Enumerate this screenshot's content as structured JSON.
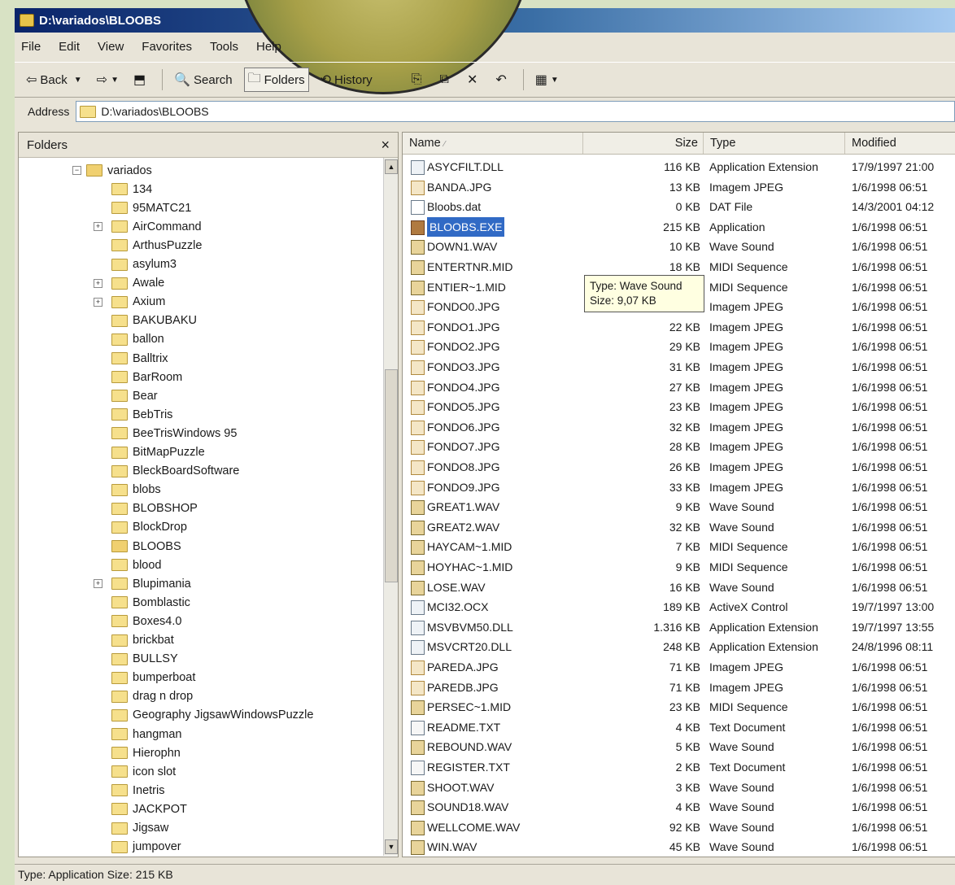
{
  "window": {
    "title": "D:\\variados\\BLOOBS"
  },
  "menu": [
    "File",
    "Edit",
    "View",
    "Favorites",
    "Tools",
    "Help"
  ],
  "toolbar": {
    "back": "Back",
    "search": "Search",
    "folders": "Folders",
    "history": "History"
  },
  "address": {
    "label": "Address",
    "value": "D:\\variados\\BLOOBS"
  },
  "folders_pane": {
    "title": "Folders",
    "close": "×",
    "root": "variados",
    "items": [
      "134",
      "95MATC21",
      "AirCommand",
      "ArthusPuzzle",
      "asylum3",
      "Awale",
      "Axium",
      "BAKUBAKU",
      "ballon",
      "Balltrix",
      "BarRoom",
      "Bear",
      "BebTris",
      "BeeTrisWindows 95",
      "BitMapPuzzle",
      "BleckBoardSoftware",
      "blobs",
      "BLOBSHOP",
      "BlockDrop",
      "BLOOBS",
      "blood",
      "Blupimania",
      "Bomblastic",
      "Boxes4.0",
      "brickbat",
      "BULLSY",
      "bumperboat",
      "drag n drop",
      "Geography JigsawWindowsPuzzle",
      "hangman",
      "Hierophn",
      "icon slot",
      "Inetris",
      "JACKPOT",
      "Jigsaw",
      "jumpover"
    ]
  },
  "columns": {
    "name": "Name",
    "size": "Size",
    "type": "Type",
    "modified": "Modified"
  },
  "files": [
    {
      "name": "ASYCFILT.DLL",
      "size": "116 KB",
      "type": "Application Extension",
      "modified": "17/9/1997 21:00",
      "icon": "dll"
    },
    {
      "name": "BANDA.JPG",
      "size": "13 KB",
      "type": "Imagem JPEG",
      "modified": "1/6/1998 06:51",
      "icon": "jpg"
    },
    {
      "name": "Bloobs.dat",
      "size": "0 KB",
      "type": "DAT File",
      "modified": "14/3/2001 04:12",
      "icon": "dat"
    },
    {
      "name": "BLOOBS.EXE",
      "size": "215 KB",
      "type": "Application",
      "modified": "1/6/1998 06:51",
      "icon": "exe"
    },
    {
      "name": "DOWN1.WAV",
      "size": "10 KB",
      "type": "Wave Sound",
      "modified": "1/6/1998 06:51",
      "icon": "wav"
    },
    {
      "name": "ENTERTNR.MID",
      "size": "18 KB",
      "type": "MIDI Sequence",
      "modified": "1/6/1998 06:51",
      "icon": "mid"
    },
    {
      "name": "ENTIER~1.MID",
      "size": "",
      "type": "MIDI Sequence",
      "modified": "1/6/1998 06:51",
      "icon": "mid"
    },
    {
      "name": "FONDO0.JPG",
      "size": "",
      "type": "Imagem JPEG",
      "modified": "1/6/1998 06:51",
      "icon": "jpg"
    },
    {
      "name": "FONDO1.JPG",
      "size": "22 KB",
      "type": "Imagem JPEG",
      "modified": "1/6/1998 06:51",
      "icon": "jpg"
    },
    {
      "name": "FONDO2.JPG",
      "size": "29 KB",
      "type": "Imagem JPEG",
      "modified": "1/6/1998 06:51",
      "icon": "jpg"
    },
    {
      "name": "FONDO3.JPG",
      "size": "31 KB",
      "type": "Imagem JPEG",
      "modified": "1/6/1998 06:51",
      "icon": "jpg"
    },
    {
      "name": "FONDO4.JPG",
      "size": "27 KB",
      "type": "Imagem JPEG",
      "modified": "1/6/1998 06:51",
      "icon": "jpg"
    },
    {
      "name": "FONDO5.JPG",
      "size": "23 KB",
      "type": "Imagem JPEG",
      "modified": "1/6/1998 06:51",
      "icon": "jpg"
    },
    {
      "name": "FONDO6.JPG",
      "size": "32 KB",
      "type": "Imagem JPEG",
      "modified": "1/6/1998 06:51",
      "icon": "jpg"
    },
    {
      "name": "FONDO7.JPG",
      "size": "28 KB",
      "type": "Imagem JPEG",
      "modified": "1/6/1998 06:51",
      "icon": "jpg"
    },
    {
      "name": "FONDO8.JPG",
      "size": "26 KB",
      "type": "Imagem JPEG",
      "modified": "1/6/1998 06:51",
      "icon": "jpg"
    },
    {
      "name": "FONDO9.JPG",
      "size": "33 KB",
      "type": "Imagem JPEG",
      "modified": "1/6/1998 06:51",
      "icon": "jpg"
    },
    {
      "name": "GREAT1.WAV",
      "size": "9 KB",
      "type": "Wave Sound",
      "modified": "1/6/1998 06:51",
      "icon": "wav"
    },
    {
      "name": "GREAT2.WAV",
      "size": "32 KB",
      "type": "Wave Sound",
      "modified": "1/6/1998 06:51",
      "icon": "wav"
    },
    {
      "name": "HAYCAM~1.MID",
      "size": "7 KB",
      "type": "MIDI Sequence",
      "modified": "1/6/1998 06:51",
      "icon": "mid"
    },
    {
      "name": "HOYHAC~1.MID",
      "size": "9 KB",
      "type": "MIDI Sequence",
      "modified": "1/6/1998 06:51",
      "icon": "mid"
    },
    {
      "name": "LOSE.WAV",
      "size": "16 KB",
      "type": "Wave Sound",
      "modified": "1/6/1998 06:51",
      "icon": "wav"
    },
    {
      "name": "MCI32.OCX",
      "size": "189 KB",
      "type": "ActiveX Control",
      "modified": "19/7/1997 13:00",
      "icon": "dll"
    },
    {
      "name": "MSVBVM50.DLL",
      "size": "1.316 KB",
      "type": "Application Extension",
      "modified": "19/7/1997 13:55",
      "icon": "dll"
    },
    {
      "name": "MSVCRT20.DLL",
      "size": "248 KB",
      "type": "Application Extension",
      "modified": "24/8/1996 08:11",
      "icon": "dll"
    },
    {
      "name": "PAREDA.JPG",
      "size": "71 KB",
      "type": "Imagem JPEG",
      "modified": "1/6/1998 06:51",
      "icon": "jpg"
    },
    {
      "name": "PAREDB.JPG",
      "size": "71 KB",
      "type": "Imagem JPEG",
      "modified": "1/6/1998 06:51",
      "icon": "jpg"
    },
    {
      "name": "PERSEC~1.MID",
      "size": "23 KB",
      "type": "MIDI Sequence",
      "modified": "1/6/1998 06:51",
      "icon": "mid"
    },
    {
      "name": "README.TXT",
      "size": "4 KB",
      "type": "Text Document",
      "modified": "1/6/1998 06:51",
      "icon": "txt"
    },
    {
      "name": "REBOUND.WAV",
      "size": "5 KB",
      "type": "Wave Sound",
      "modified": "1/6/1998 06:51",
      "icon": "wav"
    },
    {
      "name": "REGISTER.TXT",
      "size": "2 KB",
      "type": "Text Document",
      "modified": "1/6/1998 06:51",
      "icon": "txt"
    },
    {
      "name": "SHOOT.WAV",
      "size": "3 KB",
      "type": "Wave Sound",
      "modified": "1/6/1998 06:51",
      "icon": "wav"
    },
    {
      "name": "SOUND18.WAV",
      "size": "4 KB",
      "type": "Wave Sound",
      "modified": "1/6/1998 06:51",
      "icon": "wav"
    },
    {
      "name": "WELLCOME.WAV",
      "size": "92 KB",
      "type": "Wave Sound",
      "modified": "1/6/1998 06:51",
      "icon": "wav"
    },
    {
      "name": "WIN.WAV",
      "size": "45 KB",
      "type": "Wave Sound",
      "modified": "1/6/1998 06:51",
      "icon": "wav"
    }
  ],
  "selected_file": "BLOOBS.EXE",
  "tooltip": {
    "line1": "Type: Wave Sound",
    "line2": "Size: 9,07 KB"
  },
  "status": "Type: Application Size: 215 KB",
  "colors": {
    "selection": "#316ac5",
    "titlebar": "#0a246a"
  }
}
